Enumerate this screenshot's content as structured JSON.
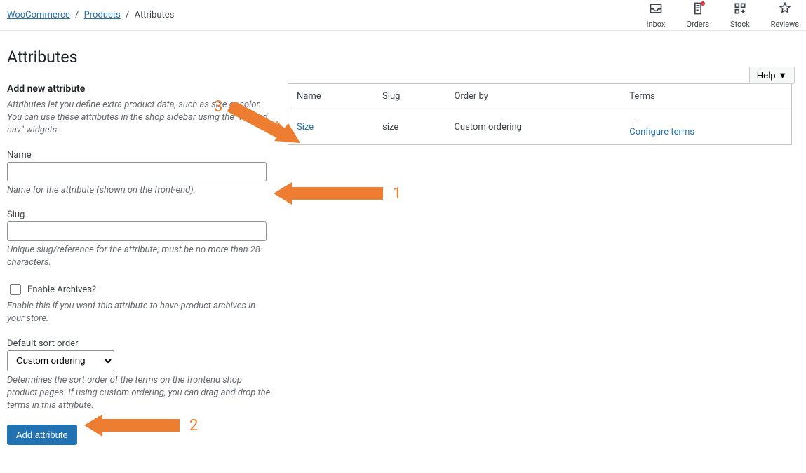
{
  "breadcrumb": {
    "root": "WooCommerce",
    "products": "Products",
    "current": "Attributes"
  },
  "topbar": {
    "inbox": "Inbox",
    "orders": "Orders",
    "stock": "Stock",
    "reviews": "Reviews"
  },
  "help_label": "Help ▼",
  "page_title": "Attributes",
  "form": {
    "header": "Add new attribute",
    "intro": "Attributes let you define extra product data, such as size or color. You can use these attributes in the shop sidebar using the \"layered nav\" widgets.",
    "name_label": "Name",
    "name_hint": "Name for the attribute (shown on the front-end).",
    "slug_label": "Slug",
    "slug_hint": "Unique slug/reference for the attribute; must be no more than 28 characters.",
    "archives_label": "Enable Archives?",
    "archives_hint": "Enable this if you want this attribute to have product archives in your store.",
    "sort_label": "Default sort order",
    "sort_value": "Custom ordering",
    "sort_hint": "Determines the sort order of the terms on the frontend shop product pages. If using custom ordering, you can drag and drop the terms in this attribute.",
    "submit": "Add attribute"
  },
  "table": {
    "headers": {
      "name": "Name",
      "slug": "Slug",
      "orderby": "Order by",
      "terms": "Terms"
    },
    "row": {
      "name": "Size",
      "slug": "size",
      "orderby": "Custom ordering",
      "terms_dash": "–",
      "configure": "Configure terms"
    }
  },
  "annotations": {
    "one": "1",
    "two": "2",
    "three": "3"
  }
}
